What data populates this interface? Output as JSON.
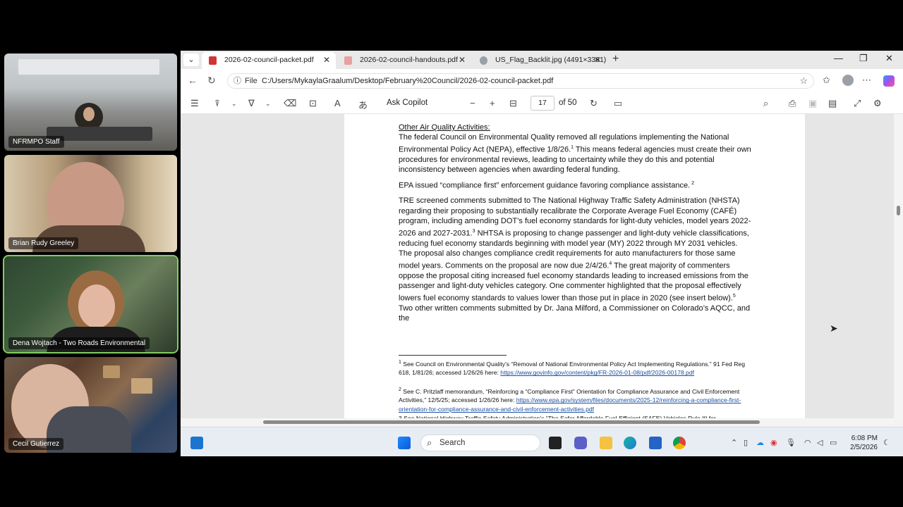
{
  "participants": [
    {
      "name": "NFRMPO Staff"
    },
    {
      "name": "Brian Rudy Greeley"
    },
    {
      "name": "Dena Wojtach - Two Roads Environmental"
    },
    {
      "name": "Cecil Gutierrez"
    }
  ],
  "browser": {
    "tabs": [
      {
        "label": "2026-02-council-packet.pdf",
        "active": true
      },
      {
        "label": "2026-02-council-handouts.pdf",
        "active": false
      },
      {
        "label": "US_Flag_Backlit.jpg (4491×3361)",
        "active": false
      }
    ],
    "new_tab": "+",
    "address": {
      "file_label": "File",
      "url": "C:/Users/MykaylaGraalum/Desktop/February%20Council/2026-02-council-packet.pdf"
    }
  },
  "pdf_toolbar": {
    "ask_copilot": "Ask Copilot",
    "page_current": "17",
    "page_total": "of 50"
  },
  "document": {
    "heading": "Other Air Quality Activities:",
    "para1": "The federal Council on Environmental Quality removed all regulations implementing the National Environmental Policy Act (NEPA), effective 1/8/26.",
    "para1_sup": "1",
    "para1_tail": " This means federal agencies must create their own procedures for environmental reviews, leading to uncertainty while they do this and potential inconsistency between agencies when awarding federal funding.",
    "para2": "EPA issued “compliance first” enforcement guidance favoring compliance assistance.",
    "para2_sup": " 2",
    "para3a": "TRE screened comments submitted to The National Highway Traffic Safety Administration (NHSTA) regarding their proposing to substantially recalibrate the Corporate Average Fuel Economy (CAFÉ) program, including amending DOT’s fuel economy standards for light-duty vehicles, model years 2022-2026 and 2027-2031.",
    "para3_sup1": "3",
    "para3b": " NHTSA is proposing to change passenger and light-duty vehicle classifications, reducing fuel economy standards beginning with model year (MY) 2022 through MY 2031 vehicles. The proposal also changes compliance credit requirements for auto manufacturers for those same model years. Comments on the proposal are now due 2/4/26.",
    "para3_sup2": "4",
    "para3c": " The great majority of commenters oppose the proposal citing increased fuel economy standards leading to increased emissions from the passenger and light-duty vehicles category. One commenter highlighted that the proposal effectively lowers fuel economy standards to values lower than those put in place in 2020 (see insert below).",
    "para3_sup3": "5",
    "para3d": "  Two other written comments submitted by Dr.  Jana Milford, a Commissioner on Colorado’s AQCC, and the",
    "fn1_num": "1",
    "fn1_text": " See Council on Environmental Quality’s “Removal of National Environmental Policy Act Implementing Regulations.” 91 Fed Reg 618, 1/81/26; accessed 1/26/26 here: ",
    "fn1_link": "https://www.govinfo.gov/content/pkg/FR-2026-01-08/pdf/2026-00178.pdf",
    "fn2_num": "2",
    "fn2_text": " See C. Pritzlaff memorandum, “Reinforcing a “Compliance First” Orientation for Compliance Assurance and Civil Enforcement Activities,”  12/5/25; accessed 1/26/26 here: ",
    "fn2_link": "https://www.epa.gov/system/files/documents/2025-12/reinforcing-a-compliance-first-orientation-for-compliance-assurance-and-civil-enforcement-activities.pdf",
    "fn3_partial": "3 See National Highway Traffic Safety Administration’s “The Safer Affordable Fuel-Efficient (SAFE) Vehicles Rule III for"
  },
  "taskbar": {
    "search_label": "Search",
    "time": "6:08 PM",
    "date": "2/5/2026"
  },
  "colors": {
    "accent": "#0067c0",
    "active_tile": "#7fcf5f"
  }
}
